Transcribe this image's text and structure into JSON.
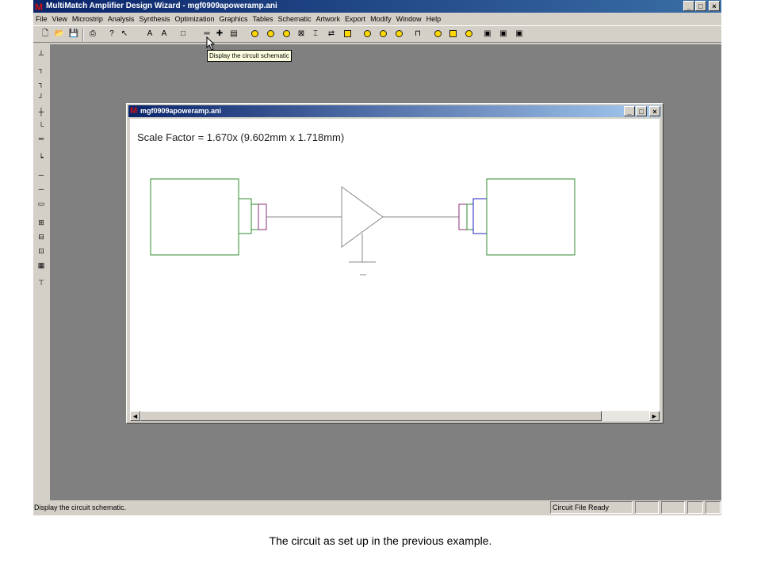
{
  "app": {
    "title": "MultiMatch Amplifier Design Wizard - mgf0909apoweramp.ani",
    "window_buttons": [
      "_",
      "□",
      "×"
    ]
  },
  "menu": [
    "File",
    "View",
    "Microstrip",
    "Analysis",
    "Synthesis",
    "Optimization",
    "Graphics",
    "Tables",
    "Schematic",
    "Artwork",
    "Export",
    "Modify",
    "Window",
    "Help"
  ],
  "toolbar": {
    "icons": [
      "new-icon",
      "open-icon",
      "save-icon",
      "print-icon",
      "help-icon",
      "pointer-icon",
      "antenna-icon",
      "antenna-2-icon",
      "text-icon",
      "schematic-icon",
      "cross-icon",
      "list-icon",
      "circle-1-icon",
      "circle-2-icon",
      "circle-3-icon",
      "box-x-icon",
      "ladder-icon",
      "arrows-icon",
      "shape-icon",
      "circle-4-icon",
      "circle-5-icon",
      "circle-6-icon",
      "chart-icon",
      "circle-7-icon",
      "square-icon",
      "circle-8-icon",
      "component-1-icon",
      "component-2-icon",
      "component-3-icon"
    ],
    "tooltip": "Display the circuit schematic"
  },
  "child_window": {
    "title": "mgf0909apoweramp.ani",
    "scale_factor": "Scale Factor =  1.670x (9.602mm x 1.718mm)"
  },
  "status": {
    "message": "Display the circuit schematic.",
    "panel": "Circuit File Ready"
  },
  "caption": "The circuit as set up in the previous example.",
  "colors": {
    "title_start": "#0a246a",
    "title_end": "#3a6ea5",
    "stub_green": "#2e8b2e",
    "stub_purple": "#8b2e7a",
    "stub_blue": "#2020c0",
    "wire_gray": "#888888"
  }
}
